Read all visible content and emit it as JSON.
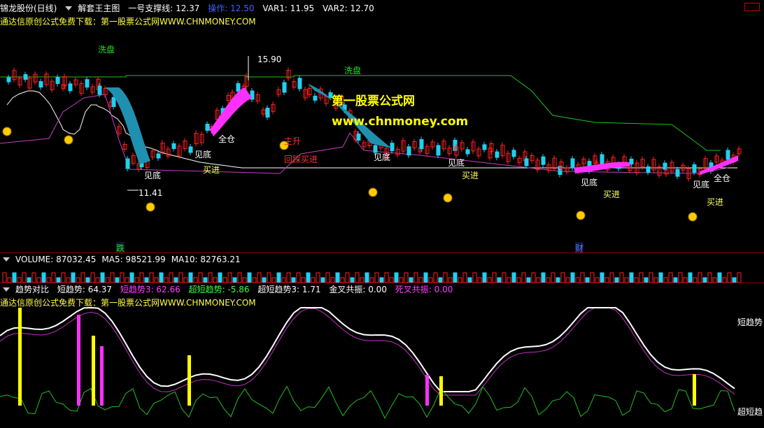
{
  "main": {
    "title": "锦龙股份(日线)",
    "indicator": "解套王主图",
    "support_label": "一号支撑线: 12.37",
    "action_label": "操作: 12.50",
    "var1": "VAR1: 11.95",
    "var2": "VAR2: 12.70",
    "promo": "通达信原创公式免费下载：第一股票公式网WWW.CHNMONEY.COM",
    "watermark_cn": "第一股票公式网",
    "watermark_url": "www.chnmoney.com",
    "high_label": "15.90",
    "low_label": "11.41",
    "markers": {
      "xipan1": "洗盘",
      "xipan2": "洗盘",
      "jiandi": "见底",
      "maijin": "买进",
      "quancang": "全仓",
      "zhusheng": "主升",
      "huicai": "回踩买进",
      "die": "跌",
      "cai": "财"
    }
  },
  "volume": {
    "label": "VOLUME: 87032.45",
    "ma5": "MA5: 98521.99",
    "ma10": "MA10: 82763.21"
  },
  "trend": {
    "title": "趋势对比",
    "short": "短趋势: 64.37",
    "short3": "短趋势3: 62.66",
    "super_short": "超短趋势: -5.86",
    "super_short3": "超短趋势3: 1.71",
    "golden": "金叉共振: 0.00",
    "death": "死叉共振: 0.00",
    "promo": "通达信原创公式免费下载：第一股票公式网WWW.CHNMONEY.COM",
    "end_short": "短趋势",
    "end_super": "超短趋"
  },
  "colors": {
    "up": "#ff2020",
    "down": "#20d0f0",
    "magenta": "#ff30ff",
    "yellow": "#ffff00",
    "green_line": "#20c020",
    "purple_line": "#c040c0",
    "white_line": "#ffffff"
  }
}
